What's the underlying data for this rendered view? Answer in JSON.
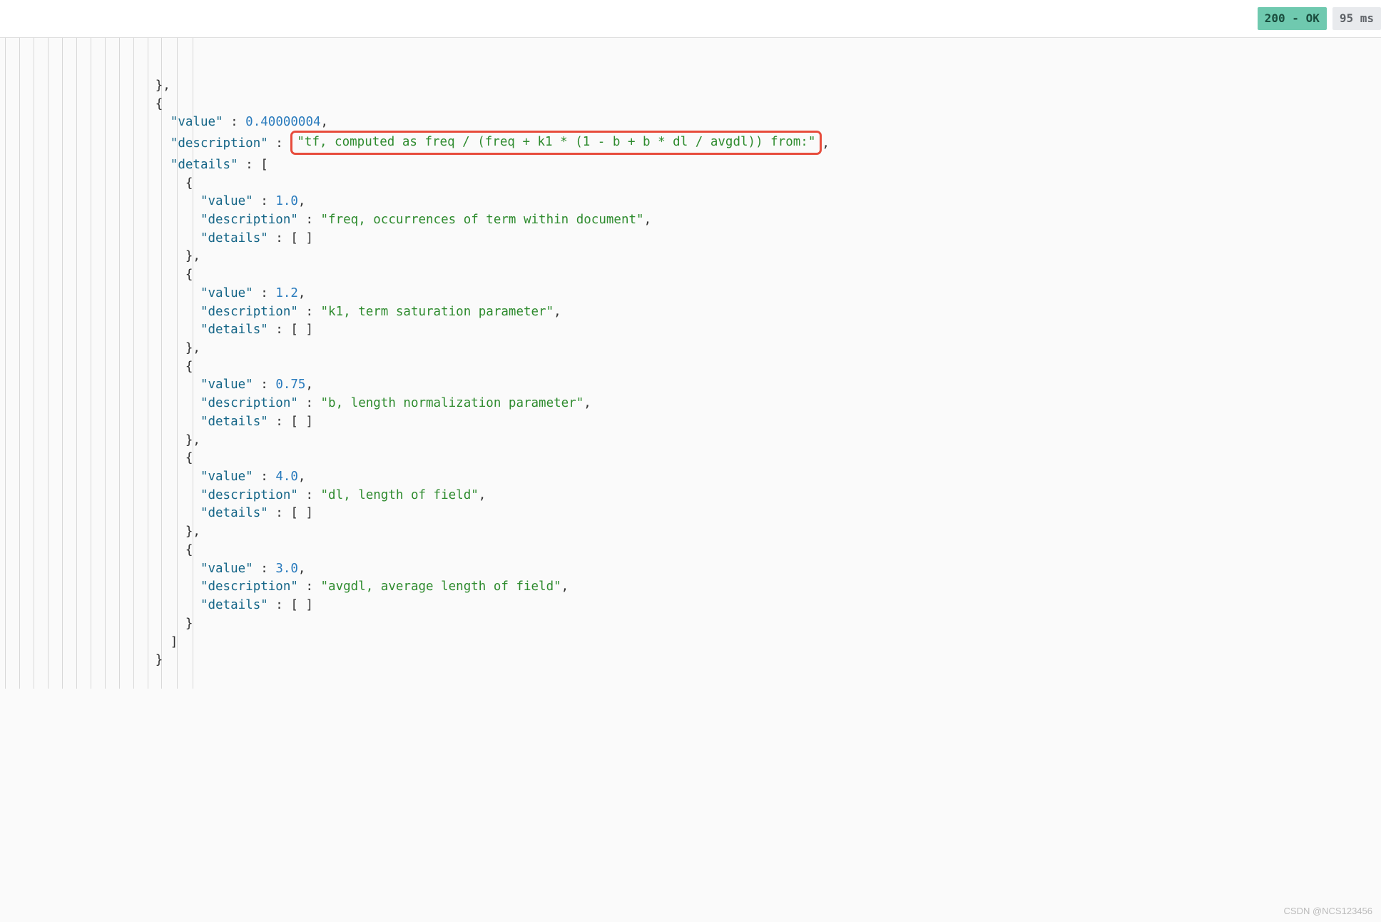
{
  "header": {
    "status": "200 - OK",
    "time": "95 ms"
  },
  "json": {
    "open_brace": "{",
    "close_brace_comma": "},",
    "close_brace": "}",
    "open_bracket": "[",
    "close_bracket": "]",
    "colon": " : ",
    "comma": ",",
    "quote": "\"",
    "value_key": "\"value\"",
    "description_key": "\"description\"",
    "details_key": "\"details\"",
    "details_empty": " : [ ]",
    "root_value": "0.40000004",
    "root_description": "\"tf, computed as freq / (freq + k1 * (1 - b + b * dl / avgdl)) from:\"",
    "items": [
      {
        "value": "1.0",
        "description": "\"freq, occurrences of term within document\""
      },
      {
        "value": "1.2",
        "description": "\"k1, term saturation parameter\""
      },
      {
        "value": "0.75",
        "description": "\"b, length normalization parameter\""
      },
      {
        "value": "4.0",
        "description": "\"dl, length of field\""
      },
      {
        "value": "3.0",
        "description": "\"avgdl, average length of field\""
      }
    ]
  },
  "watermark": "CSDN @NCS123456"
}
